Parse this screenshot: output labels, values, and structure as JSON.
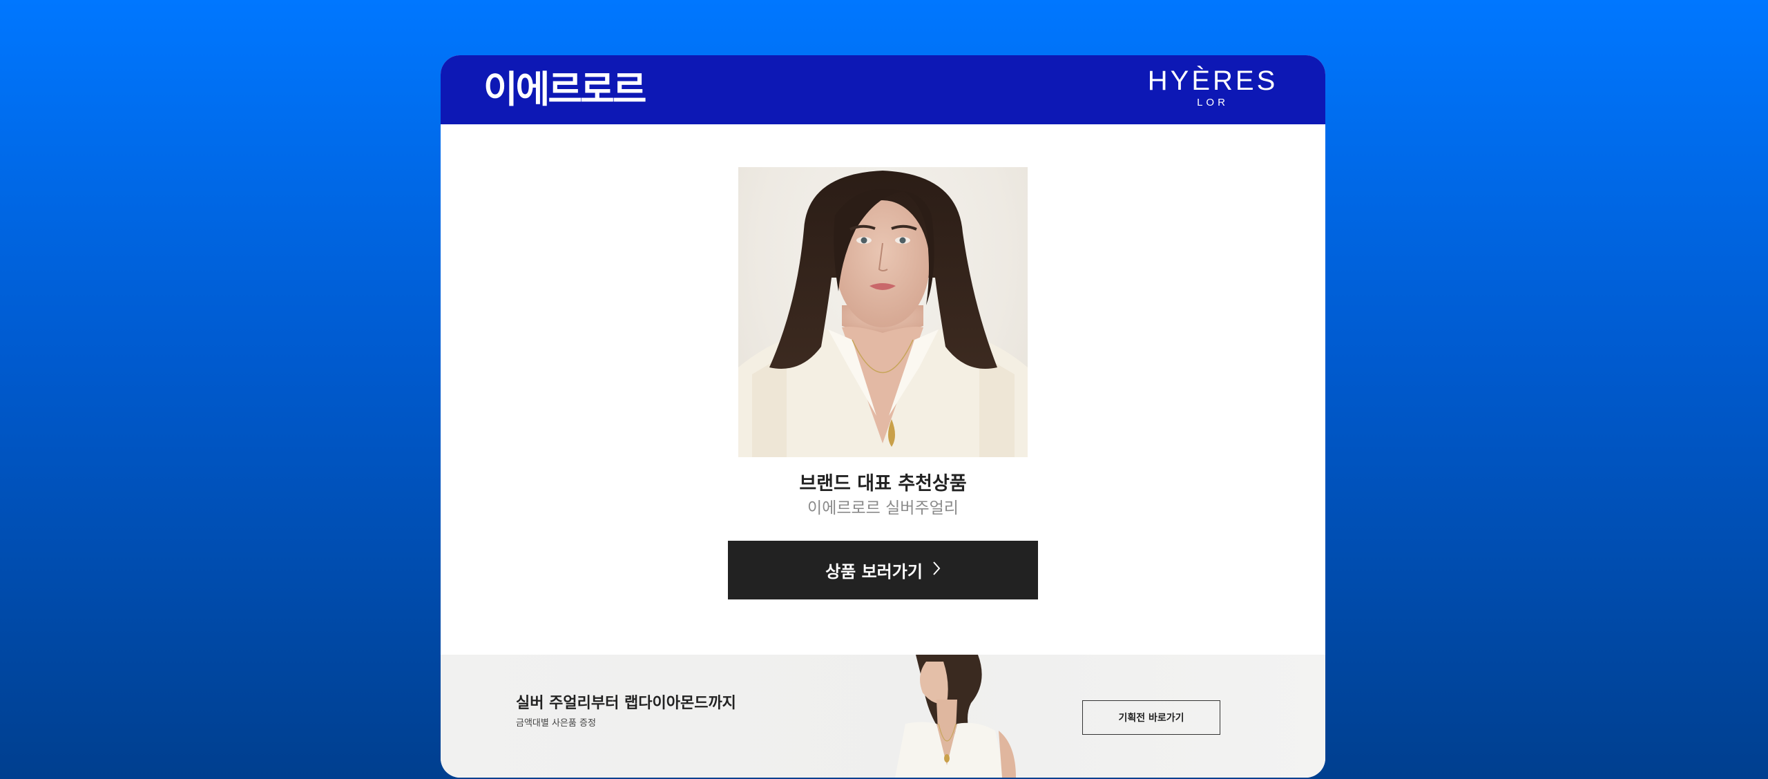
{
  "header": {
    "brand_korean": "이에르로르",
    "brand_logo_main": "HYÈRES",
    "brand_logo_sub": "LOR"
  },
  "product": {
    "image_alt": "model-portrait",
    "title": "브랜드 대표 추천상품",
    "subtitle": "이에르로르 실버주얼리",
    "cta_label": "상품 보러가기",
    "cta_icon": "chevron-right-icon"
  },
  "banner": {
    "title": "실버 주얼리부터 랩다이아몬드까지",
    "subtitle": "금액대별 사은품 증정",
    "button_label": "기획전 바로가기"
  },
  "colors": {
    "page_bg_top": "#0077ff",
    "page_bg_bottom": "#003f8f",
    "header_bg": "#0d18b5",
    "cta_bg": "#222222",
    "banner_bg": "#f1f1f0"
  }
}
